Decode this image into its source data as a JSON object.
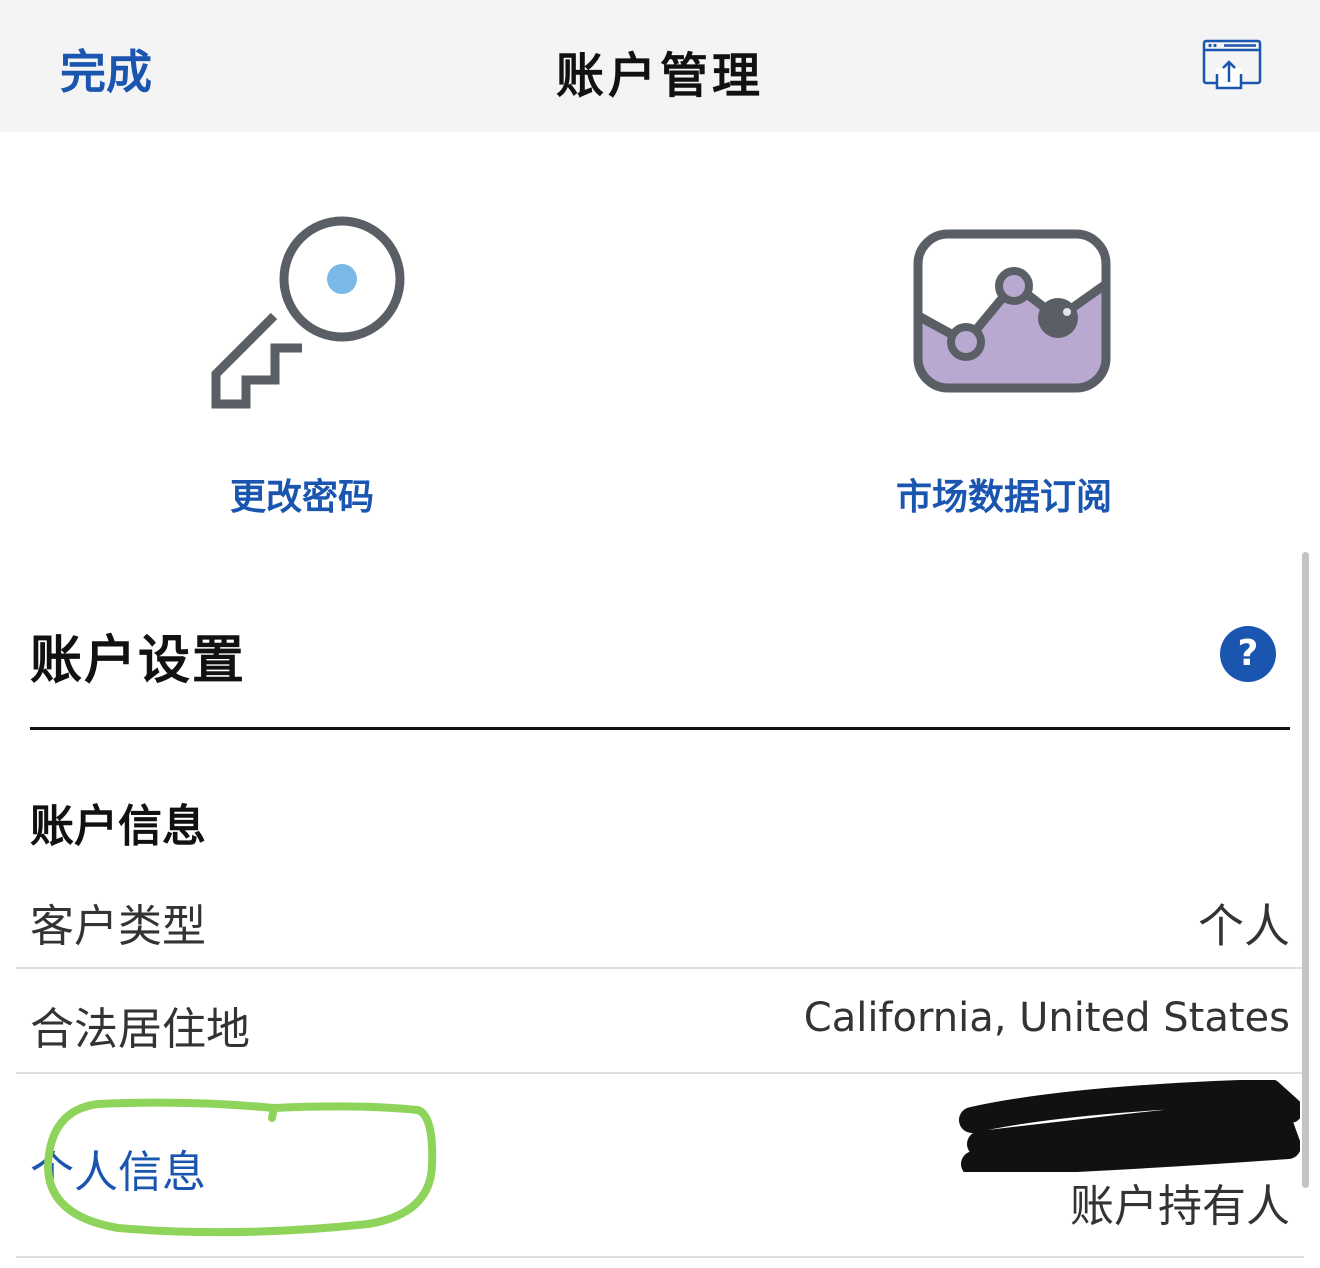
{
  "navbar": {
    "done_label": "完成",
    "title": "账户管理",
    "share_icon": "share-window-icon"
  },
  "quick_actions": [
    {
      "label": "更改密码",
      "icon": "key-icon"
    },
    {
      "label": "市场数据订阅",
      "icon": "market-chart-icon"
    }
  ],
  "section": {
    "title": "账户设置",
    "help_label": "?"
  },
  "account_info": {
    "title": "账户信息",
    "rows": [
      {
        "label": "客户类型",
        "value": "个人"
      },
      {
        "label": "合法居住地",
        "value": "California, United States"
      },
      {
        "label": "个人信息",
        "value": "账户持有人"
      }
    ]
  },
  "colors": {
    "accent": "#1a55b0",
    "highlight": "#8ed45a",
    "icon_gray": "#5a5f66",
    "icon_dot": "#7ab8e8",
    "chart_fill": "#b9a8cf"
  }
}
